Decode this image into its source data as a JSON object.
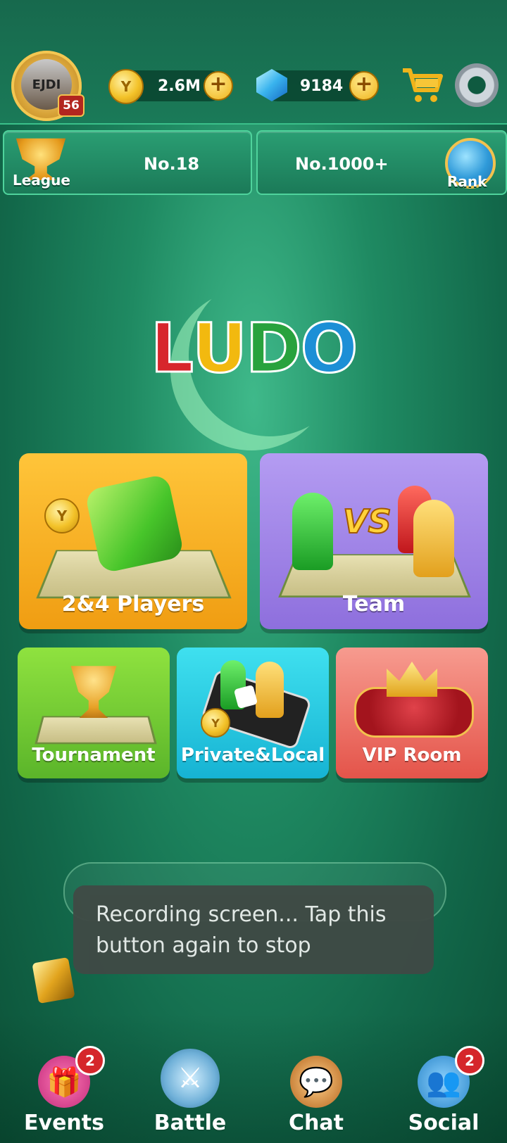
{
  "header": {
    "level": "56",
    "avatar_initials": "EJDI",
    "coins": "2.6M",
    "gems": "9184",
    "plus_symbol": "+"
  },
  "ranking": {
    "league_label": "League",
    "league_value": "No.18",
    "rank_value": "No.1000+",
    "rank_label": "Rank"
  },
  "logo": {
    "letters": [
      {
        "ch": "L",
        "color": "#d7262c"
      },
      {
        "ch": "U",
        "color": "#f2b90f"
      },
      {
        "ch": "D",
        "color": "#28a23d"
      },
      {
        "ch": "O",
        "color": "#1c8fd6"
      }
    ]
  },
  "modes": {
    "players": "2&4 Players",
    "team": "Team",
    "vs_text": "VS",
    "tournament": "Tournament",
    "private_local": "Private&Local",
    "vip_room": "VIP Room"
  },
  "toast": {
    "message": "Recording screen... Tap this button again to stop"
  },
  "nav": {
    "events": {
      "label": "Events",
      "badge": "2"
    },
    "battle": {
      "label": "Battle"
    },
    "chat": {
      "label": "Chat"
    },
    "social": {
      "label": "Social",
      "badge": "2"
    }
  },
  "colors": {
    "background": "#1f8a62",
    "tile_players": "#f4a81c",
    "tile_team": "#9b7ee6",
    "tile_tournament": "#79d033",
    "tile_private": "#22c6e0",
    "tile_vip": "#ef6e63"
  }
}
